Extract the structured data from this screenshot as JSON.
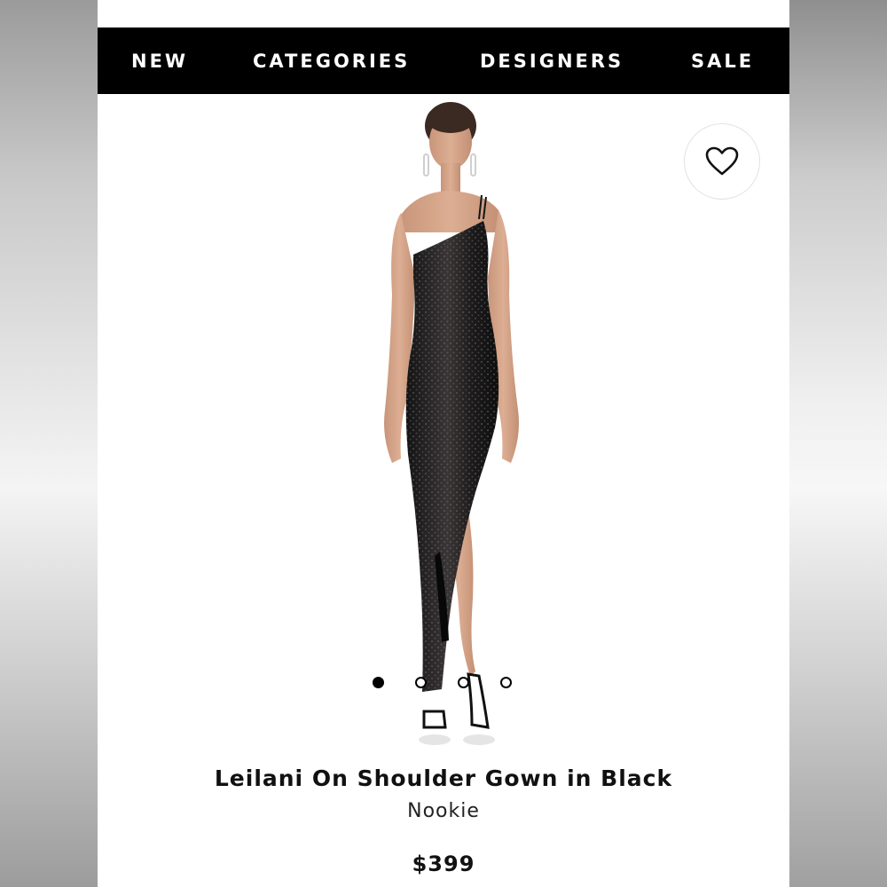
{
  "nav": {
    "items": [
      {
        "label": "NEW"
      },
      {
        "label": "CATEGORIES"
      },
      {
        "label": "DESIGNERS"
      },
      {
        "label": "SALE"
      }
    ]
  },
  "favorite": {
    "icon": "heart-icon"
  },
  "gallery": {
    "image_subject": "model wearing a black sequin one-shoulder gown with high slit",
    "total_slides": 4,
    "active_slide": 1
  },
  "product": {
    "title": "Leilani On Shoulder Gown in Black",
    "brand": "Nookie",
    "price": "$399"
  },
  "colors": {
    "nav_background": "#000000",
    "nav_text": "#ffffff",
    "text_primary": "#111111"
  }
}
